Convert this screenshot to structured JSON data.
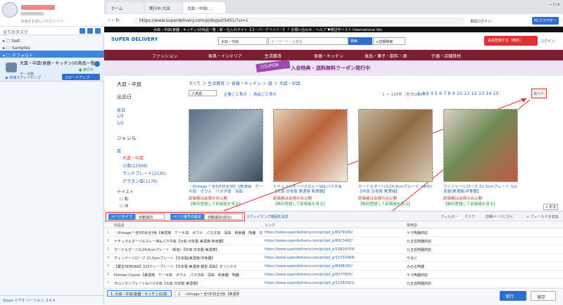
{
  "left": {
    "hint": "料金をお試しいただく＞＞",
    "all_tasks": "全てのタスク",
    "tree": [
      "test",
      "Samples",
      "デフォルト"
    ],
    "task": {
      "name": "大皿・中皿(食器・キッチン)の商品一覧｜卸・",
      "status": "● 実行中",
      "data_label": "データ数",
      "local_run": "▶ 高速スクレイピング",
      "speed_btn": "スピードアップ"
    },
    "footer": "Skype  ビデオ                         バージョン: 3.6.4"
  },
  "browser": {
    "tabs": [
      "ホーム",
      "実行中:大皿",
      "大皿・中皿(…"
    ],
    "url": "https://www.superdelivery.com/p/do/psl/5451/?vi=1",
    "window_right": "事前ログイン",
    "pc_browser": "PCブラウザー",
    "site_header": "大皿・中皿(食器・キッチン)の商品一覧｜卸・仕入れサイト【スーパーデリバリー】                    ？お問い合わせ・ヘルプ  ♥検討中リスト  International Ver.",
    "logo": "SUPER DELIVERY",
    "select": "大皿・中皿",
    "keyword_placeholder": "キーワード・企業名",
    "search_btn": "検索",
    "detail_btn": "+詳細検索",
    "register_btn": "会員登録する（無料）",
    "login": "ログイン",
    "categories": [
      "ファッション",
      "家具・インテリア",
      "生活雑貨",
      "食器・キッチン",
      "食品・菓子・飲料・酒",
      "什器・店舗資材"
    ],
    "banner_coupon": "COUPON",
    "banner_text": "- 入会特典 - 送料無料クーポン発行中",
    "sidebar": {
      "title": "大皿・中皿",
      "date_head": "出品日",
      "dates": [
        "本日",
        "1/3",
        "1/2"
      ],
      "genre_head": "ジャンル",
      "genres": [
        "皿",
        "大皿・中皿",
        "小皿(13306)",
        "ランチプレート(2130)",
        "グラタン皿(1170)"
      ],
      "taste_head": "テイスト",
      "tastes": [
        "和",
        "洋"
      ]
    },
    "breadcrumb": "すべて ＞ 生活雑貨 ＞ 食器・キッチン ＞ 皿 ＞ 大皿・中皿",
    "sort": "人気順",
    "view_links": "企業ごと表示 ｜ 商品ごと表示",
    "pager_info": "1 ～ 120件（全35282件）",
    "pages": "1  2  3  4  5  6  7  8  9  10  11  12  13  14  15",
    "next": "次へ＞",
    "products": [
      {
        "title": "＼Vintage * 全5形状全3色【美濃焼　ケー キ皿　ボウル　パスタ皿　深皿",
        "members": "卸価格は会員のみ公開",
        "free": "【無料登録して卸価格を見る】"
      },
      {
        "title": "ナチュラルオーバルカレー皿&パスタ皿【大皿 日本製 美濃焼 和食器】",
        "members": "卸価格は会員のみ公開",
        "free": "【無料登録して卸価格を見る】"
      },
      {
        "title": "カードルオーバル24.6cmプレート（新色）【中皿 日本製 美濃焼】",
        "members": "卸価格は会員のみ公開",
        "free": "【無料登録して卸価格を見る】"
      },
      {
        "title": "ヴィンテージローズ 21.5cmプレート【日本製|美濃焼/洋食器】",
        "members": "卸価格は会員のみ公開",
        "free": "【無料登録して卸価格を見る】"
      }
    ]
  },
  "panel": {
    "page_type_btn": "ページタイプ",
    "page_type_val": "自動識別",
    "page_num_btn": "ページ番号の設定",
    "page_num_val": "自動識別(成功)",
    "scroll_link": "スクレイピング範囲を設定",
    "filter": "フィルター",
    "clear": "クリア",
    "detail": "詳細ページに行く",
    "add_field": "+ フィールドを追加",
    "headers": [
      "商品名",
      "リンク",
      "販売店"
    ],
    "rows": [
      [
        "1",
        "＼Vintage * 全5形状全3色【美濃焼　ケーキ皿　ボウル　パスタ皿　深皿　和食器　陶器　洋",
        "https://www.superdelivery.com/p/r/pd_p/8579206/",
        "ヤマ陶器商店"
      ],
      [
        "2",
        "ナチュラルオーバルカレー皿&パスタ皿【大皿 日本製 美濃焼 和食器】",
        "https://www.superdelivery.com/p/r/pd_p/8921492/",
        "九五伯陶器商店"
      ],
      [
        "3",
        "カードルオーバル24.6cmプレート（新色）【中皿 日本製 美濃焼】",
        "https://www.superdelivery.com/p/r/pd_p/15824704/",
        "九五伯陶器商店"
      ],
      [
        "4",
        "ヴィンテージローズ 21.5cmプレート【日本製|美濃焼/洋食器】",
        "https://www.superdelivery.com/p/r/pd_p/11533489/",
        "やまに"
      ],
      [
        "5",
        "【業定SENDAN】225ティープレート【日本製 美濃焼 雑貨 深皿】オリジナル",
        "https://www.superdelivery.com/p/r/pd_p/8398165/",
        "みのる陶器"
      ],
      [
        "6",
        "Potman Classic【美濃焼　ケーキ皿　ボウル　パスタ皿　深皿　和食器　陶器",
        "https://www.superdelivery.com/p/r/pd_p/9577655/",
        "ヤマ陶器商店"
      ],
      [
        "7",
        "モロッカンプレート&パスタ皿【大皿 日本製 美濃焼】",
        "https://www.superdelivery.com/p/r/pd_p/11582501/",
        "九五伯陶器商店"
      ]
    ],
    "footer_tabs": [
      "1. 大皿・中皿(食器・キッチン)の商",
      "2. ＼Vintage * 全5形状全3色【美濃焼"
    ],
    "run": "実行",
    "save": "保存"
  }
}
